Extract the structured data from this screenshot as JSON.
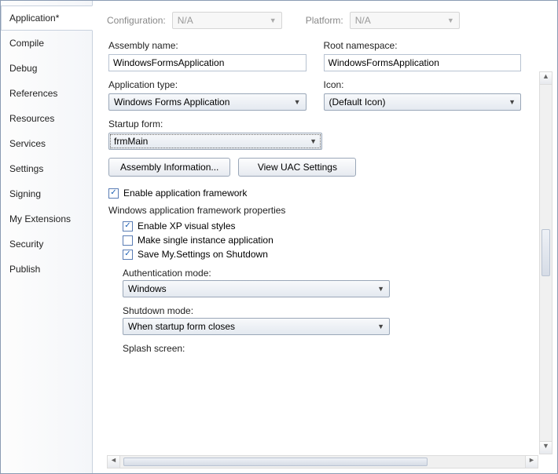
{
  "tabs": [
    {
      "label": "Application*",
      "active": true
    },
    {
      "label": "Compile"
    },
    {
      "label": "Debug"
    },
    {
      "label": "References"
    },
    {
      "label": "Resources"
    },
    {
      "label": "Services"
    },
    {
      "label": "Settings"
    },
    {
      "label": "Signing"
    },
    {
      "label": "My Extensions"
    },
    {
      "label": "Security"
    },
    {
      "label": "Publish"
    }
  ],
  "topbar": {
    "configuration_label": "Configuration:",
    "configuration_value": "N/A",
    "platform_label": "Platform:",
    "platform_value": "N/A"
  },
  "fields": {
    "assembly_name_label": "Assembly name:",
    "assembly_name_value": "WindowsFormsApplication",
    "root_namespace_label": "Root namespace:",
    "root_namespace_value": "WindowsFormsApplication",
    "application_type_label": "Application type:",
    "application_type_value": "Windows Forms Application",
    "icon_label": "Icon:",
    "icon_value": "(Default Icon)",
    "startup_form_label": "Startup form:",
    "startup_form_value": "frmMain"
  },
  "buttons": {
    "assembly_info": "Assembly Information...",
    "view_uac": "View UAC Settings"
  },
  "framework": {
    "enable_label": "Enable application framework",
    "enable_checked": true,
    "section_title": "Windows application framework properties",
    "xp_styles_label": "Enable XP visual styles",
    "xp_styles_checked": true,
    "single_instance_label": "Make single instance application",
    "single_instance_checked": false,
    "save_settings_label": "Save My.Settings on Shutdown",
    "save_settings_checked": true,
    "auth_mode_label": "Authentication mode:",
    "auth_mode_value": "Windows",
    "shutdown_mode_label": "Shutdown mode:",
    "shutdown_mode_value": "When startup form closes",
    "splash_label": "Splash screen:"
  }
}
